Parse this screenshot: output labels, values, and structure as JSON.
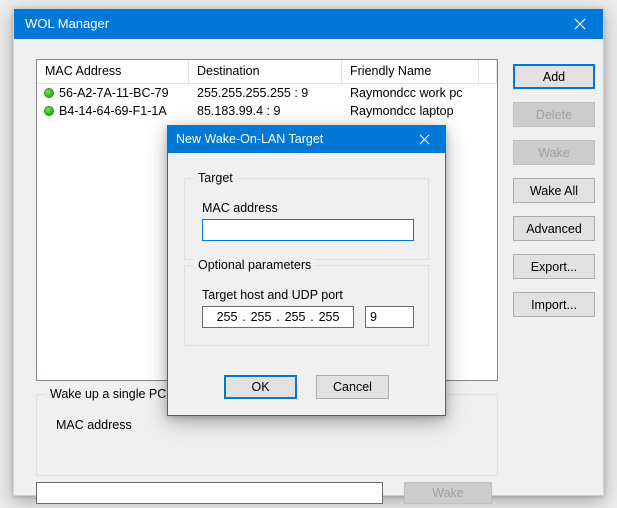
{
  "window": {
    "title": "WOL Manager",
    "close_icon": "close-icon"
  },
  "list": {
    "columns": [
      "MAC Address",
      "Destination",
      "Friendly Name",
      ""
    ],
    "rows": [
      {
        "status": "online",
        "mac": "56-A2-7A-11-BC-79",
        "destination": "255.255.255.255 : 9",
        "friendly_name": "Raymondcc work pc"
      },
      {
        "status": "online",
        "mac": "B4-14-64-69-F1-1A",
        "destination": "85.183.99.4 : 9",
        "friendly_name": "Raymondcc laptop"
      }
    ]
  },
  "side_buttons": [
    {
      "label": "Add",
      "state": "default"
    },
    {
      "label": "Delete",
      "state": "disabled"
    },
    {
      "label": "Wake",
      "state": "disabled"
    },
    {
      "label": "Wake All",
      "state": "normal"
    },
    {
      "label": "Advanced",
      "state": "normal"
    },
    {
      "label": "Export...",
      "state": "normal"
    },
    {
      "label": "Import...",
      "state": "normal"
    }
  ],
  "bottom_group": {
    "title": "Wake up a single PC",
    "mac_label": "MAC address",
    "mac_value": "",
    "mac_placeholder": "",
    "wake_button": "Wake"
  },
  "dialog": {
    "title": "New Wake-On-LAN Target",
    "close_icon": "close-icon",
    "target_group": {
      "title": "Target",
      "mac_label": "MAC address",
      "mac_value": "",
      "mac_placeholder": ""
    },
    "optional_group": {
      "title": "Optional parameters",
      "host_label": "Target host and UDP port",
      "ip_octets": [
        "255",
        "255",
        "255",
        "255"
      ],
      "ip_separator": ".",
      "port_value": "9"
    },
    "ok_label": "OK",
    "cancel_label": "Cancel"
  },
  "colors": {
    "accent": "#0078d7",
    "window_bg": "#f0f0f0",
    "status_online": "#35c020"
  }
}
